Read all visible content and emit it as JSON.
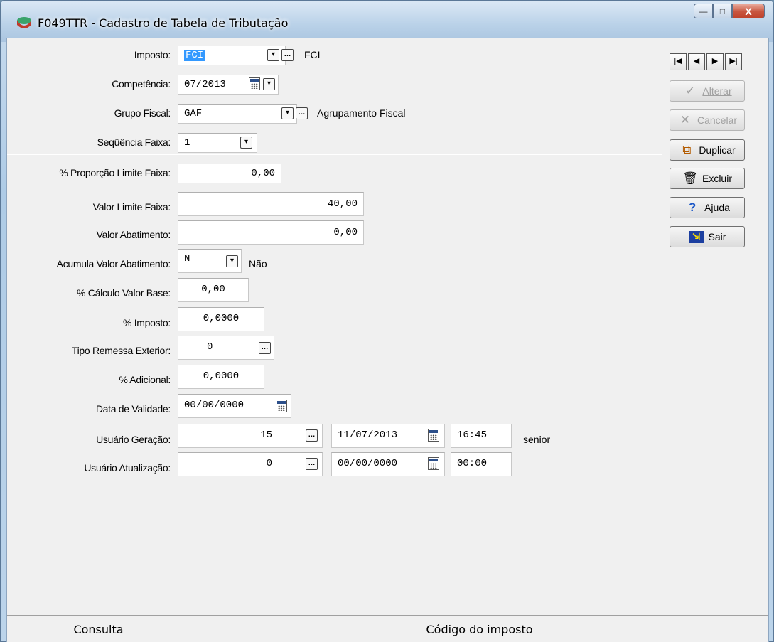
{
  "window": {
    "title": "F049TTR - Cadastro de Tabela de Tributação",
    "controls": {
      "minimize": "—",
      "maximize": "□",
      "close": "X"
    }
  },
  "form": {
    "imposto": {
      "label": "Imposto:",
      "value": "FCI",
      "desc": "FCI"
    },
    "competencia": {
      "label": "Competência:",
      "value": "07/2013"
    },
    "grupo_fiscal": {
      "label": "Grupo Fiscal:",
      "value": "GAF",
      "desc": "Agrupamento Fiscal"
    },
    "sequencia_faixa": {
      "label": "Seqüência Faixa:",
      "value": "1"
    },
    "proporcao_limite": {
      "label": "% Proporção Limite Faixa:",
      "value": "0,00"
    },
    "valor_limite": {
      "label": "Valor Limite Faixa:",
      "value": "40,00"
    },
    "valor_abatimento": {
      "label": "Valor Abatimento:",
      "value": "0,00"
    },
    "acumula_abatimento": {
      "label": "Acumula Valor Abatimento:",
      "value": "N",
      "desc": "Não"
    },
    "calculo_base": {
      "label": "% Cálculo Valor Base:",
      "value": "0,00"
    },
    "imposto_pct": {
      "label": "% Imposto:",
      "value": "0,0000"
    },
    "tipo_remessa": {
      "label": "Tipo Remessa Exterior:",
      "value": "0"
    },
    "adicional": {
      "label": "% Adicional:",
      "value": "0,0000"
    },
    "data_validade": {
      "label": "Data de Validade:",
      "value": "00/00/0000"
    },
    "usuario_geracao": {
      "label": "Usuário Geração:",
      "user": "15",
      "date": "11/07/2013",
      "time": "16:45",
      "name": "senior"
    },
    "usuario_atualizacao": {
      "label": "Usuário Atualização:",
      "user": "0",
      "date": "00/00/0000",
      "time": "00:00"
    }
  },
  "buttons": {
    "nav": [
      "|◀",
      "◀",
      "▶",
      "▶|"
    ],
    "alterar": "Alterar",
    "cancelar": "Cancelar",
    "duplicar": "Duplicar",
    "excluir": "Excluir",
    "ajuda": "Ajuda",
    "sair": "Sair"
  },
  "status": {
    "mode": "Consulta",
    "hint": "Código do imposto"
  }
}
